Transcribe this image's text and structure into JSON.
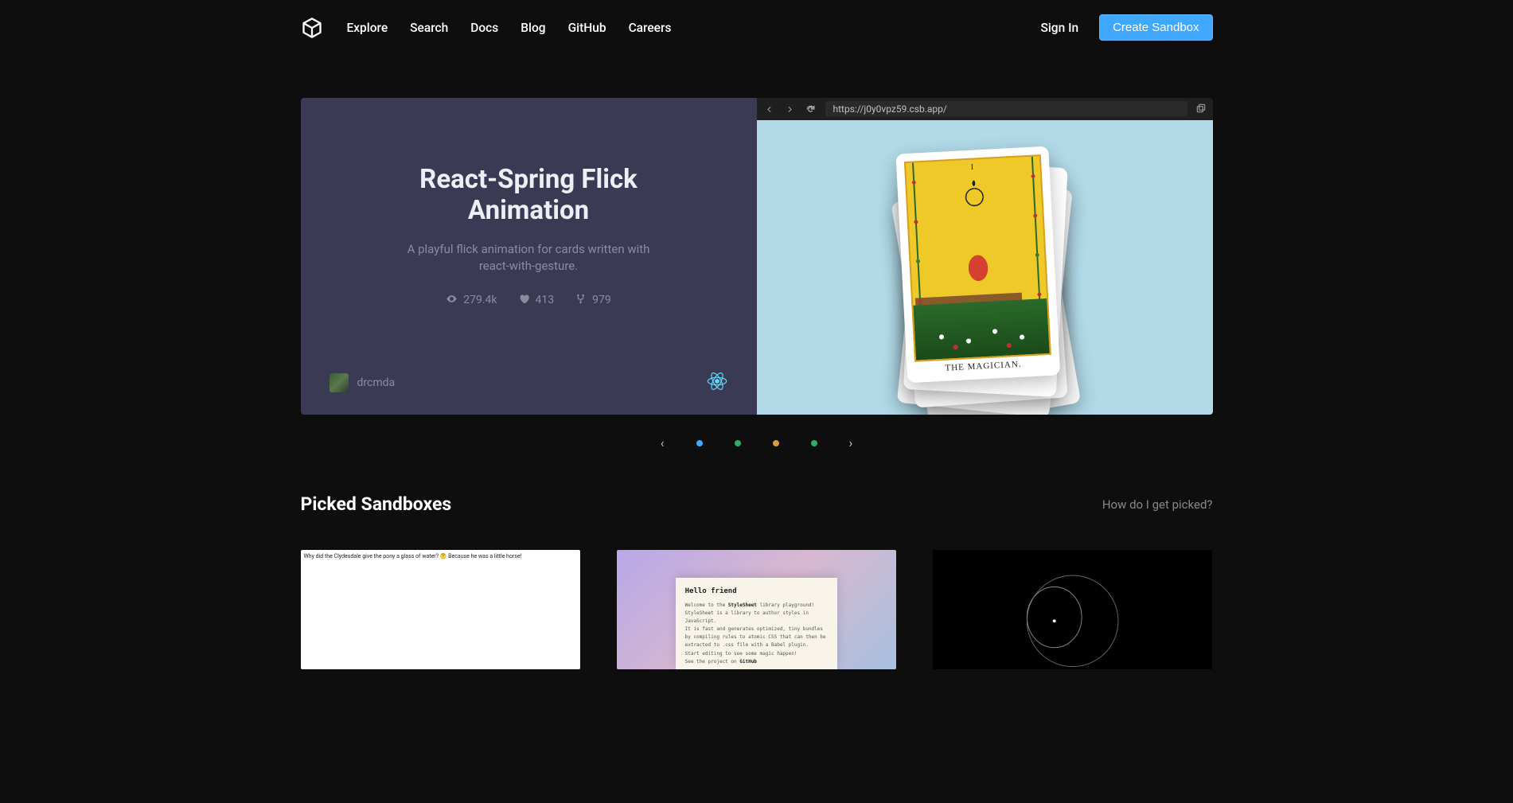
{
  "nav": {
    "links": [
      "Explore",
      "Search",
      "Docs",
      "Blog",
      "GitHub",
      "Careers"
    ],
    "signin": "Sign In",
    "create": "Create Sandbox"
  },
  "hero": {
    "title": "React-Spring Flick Animation",
    "description": "A playful flick animation for cards written with react-with-gesture.",
    "views": "279.4k",
    "likes": "413",
    "forks": "979",
    "author": "drcmda",
    "preview_url": "https://j0y0vpz59.csb.app/",
    "tarot_caption": "THE MAGICIAN.",
    "tarot_numeral": "I"
  },
  "carousel": {
    "dot_colors": [
      "#40a9ff",
      "#2fad6a",
      "#d89a3a",
      "#2fad6a"
    ],
    "active": 0
  },
  "picked": {
    "title": "Picked Sandboxes",
    "link": "How do I get picked?",
    "card1_text": "Why did the Clydesdale give the pony a glass of water? 🤔 Because he was a little horse!",
    "card2": {
      "heading": "Hello friend",
      "l1_a": "Welcome to the ",
      "l1_b": "StyleSheet",
      "l1_c": " library playground!",
      "l2": "StyleSheet is a library to author styles in JavaScript.",
      "l3": "It is fast and generates optimized, tiny bundles by compiling rules to atomic CSS that can then be extracted to .css file with a Babel plugin.",
      "l4": "Start editing to see some magic happen!",
      "l5_a": "See the project on ",
      "l5_b": "GitHub"
    }
  }
}
